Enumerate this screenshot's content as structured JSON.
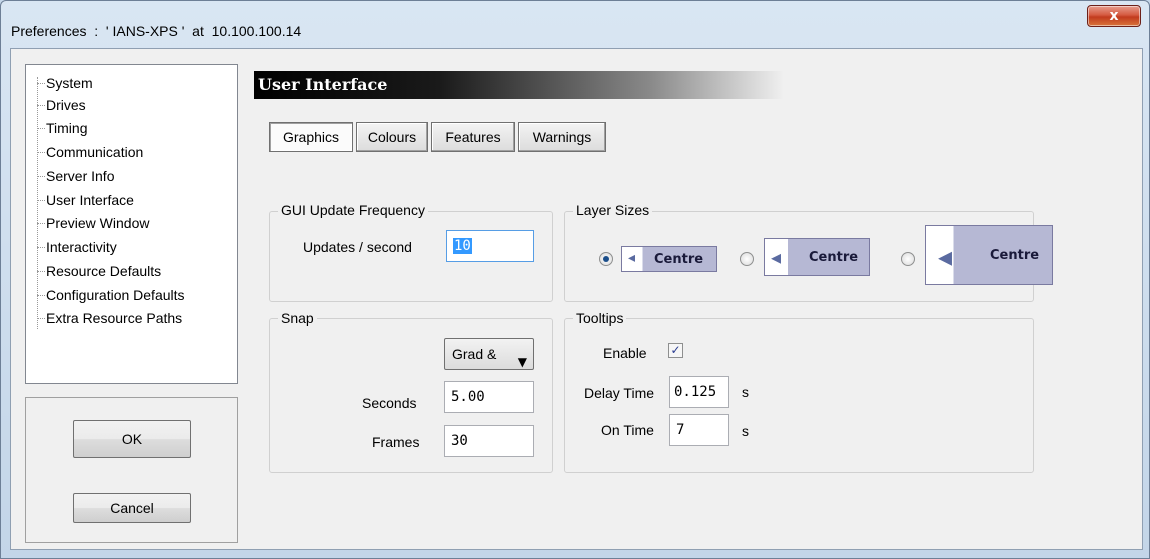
{
  "window": {
    "title": "Preferences  :  ' IANS-XPS '  at  10.100.100.14",
    "close_glyph": "x"
  },
  "tree": {
    "items": [
      {
        "label": "System"
      },
      {
        "label": "Drives"
      },
      {
        "label": "Timing"
      },
      {
        "label": "Communication"
      },
      {
        "label": "Server Info"
      },
      {
        "label": "User Interface",
        "selected": true
      },
      {
        "label": "Preview Window"
      },
      {
        "label": "Interactivity"
      },
      {
        "label": "Resource Defaults"
      },
      {
        "label": "Configuration Defaults"
      },
      {
        "label": "Extra Resource Paths"
      }
    ]
  },
  "buttons": {
    "ok": "OK",
    "cancel": "Cancel"
  },
  "section": {
    "title": "User Interface"
  },
  "tabs": [
    {
      "label": "Graphics",
      "active": true
    },
    {
      "label": "Colours"
    },
    {
      "label": "Features"
    },
    {
      "label": "Warnings"
    }
  ],
  "gui_update": {
    "legend": "GUI Update Frequency",
    "updates_label": "Updates / second",
    "updates_value": "10"
  },
  "layer_sizes": {
    "legend": "Layer Sizes",
    "options": [
      {
        "label": "Centre",
        "selected": true,
        "icon": "speaker-icon"
      },
      {
        "label": "Centre",
        "selected": false,
        "icon": "speaker-icon"
      },
      {
        "label": "Centre",
        "selected": false,
        "icon": "speaker-icon"
      }
    ]
  },
  "snap": {
    "legend": "Snap",
    "mode_value": "Grad &",
    "seconds_label": "Seconds",
    "seconds_value": "5.00",
    "frames_label": "Frames",
    "frames_value": "30"
  },
  "tooltips": {
    "legend": "Tooltips",
    "enable_label": "Enable",
    "enable_checked": true,
    "delay_label": "Delay Time",
    "delay_value": "0.125",
    "delay_unit": "s",
    "on_label": "On Time",
    "on_value": "7",
    "on_unit": "s"
  },
  "colors": {
    "close_button": "#c94a30",
    "header_bg": "#000000",
    "layer_button_fill": "#b6b8d4",
    "selection": "#3399ff"
  }
}
